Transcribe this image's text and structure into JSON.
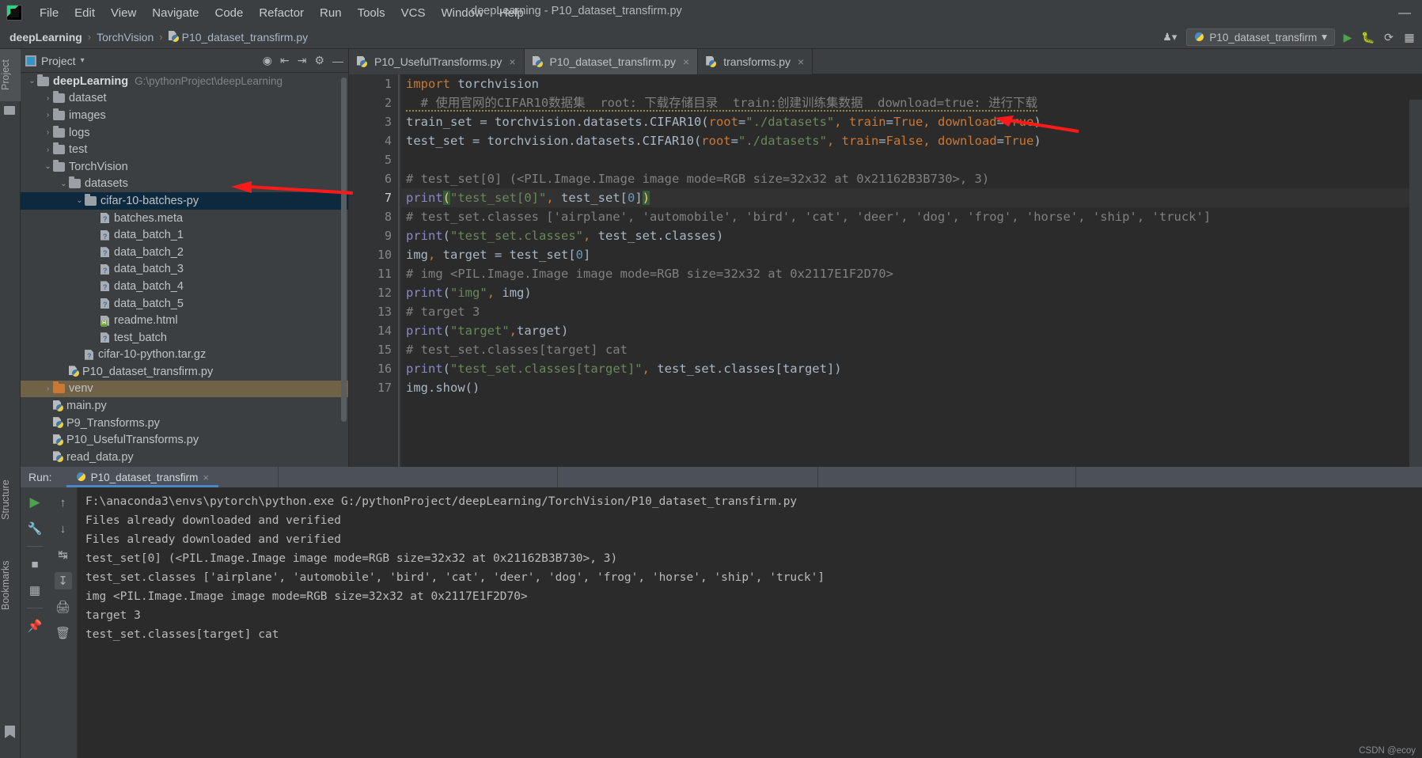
{
  "window": {
    "title": "deepLearning - P10_dataset_transfirm.py",
    "minimize_glyph": "—"
  },
  "menu": {
    "logo_text": "PC",
    "items": [
      "File",
      "Edit",
      "View",
      "Navigate",
      "Code",
      "Refactor",
      "Run",
      "Tools",
      "VCS",
      "Window",
      "Help"
    ]
  },
  "breadcrumb": {
    "items": [
      "deepLearning",
      "TorchVision",
      "P10_dataset_transfirm.py"
    ],
    "separator": "›"
  },
  "toolbar": {
    "account_glyph": "♟",
    "caret_glyph": "▾",
    "run_config": "P10_dataset_transfirm",
    "run_glyph": "▶",
    "debug_glyph": "⚙",
    "coverage_glyph": "⟳",
    "profile_glyph": "▦"
  },
  "left_strip": {
    "tabs": [
      "Project",
      "Structure",
      "Bookmarks"
    ]
  },
  "project_panel": {
    "title": "Project",
    "caret": "▾",
    "header_icons": [
      "locate-icon",
      "expand-all-icon",
      "collapse-all-icon",
      "settings-icon",
      "hide-icon"
    ],
    "tree": [
      {
        "label": "deepLearning",
        "path": "G:\\pythonProject\\deepLearning",
        "depth": 0,
        "arrow": "⌄",
        "icon": "folder",
        "bold": true,
        "state": "normal"
      },
      {
        "label": "dataset",
        "path": "",
        "depth": 1,
        "arrow": "›",
        "icon": "folder",
        "bold": false,
        "state": "normal"
      },
      {
        "label": "images",
        "path": "",
        "depth": 1,
        "arrow": "›",
        "icon": "folder",
        "bold": false,
        "state": "normal"
      },
      {
        "label": "logs",
        "path": "",
        "depth": 1,
        "arrow": "›",
        "icon": "folder",
        "bold": false,
        "state": "normal"
      },
      {
        "label": "test",
        "path": "",
        "depth": 1,
        "arrow": "›",
        "icon": "folder",
        "bold": false,
        "state": "normal"
      },
      {
        "label": "TorchVision",
        "path": "",
        "depth": 1,
        "arrow": "⌄",
        "icon": "folder",
        "bold": false,
        "state": "normal"
      },
      {
        "label": "datasets",
        "path": "",
        "depth": 2,
        "arrow": "⌄",
        "icon": "folder",
        "bold": false,
        "state": "normal"
      },
      {
        "label": "cifar-10-batches-py",
        "path": "",
        "depth": 3,
        "arrow": "⌄",
        "icon": "folder",
        "bold": false,
        "state": "selected"
      },
      {
        "label": "batches.meta",
        "path": "",
        "depth": 4,
        "arrow": "",
        "icon": "file-unknown",
        "bold": false,
        "state": "normal"
      },
      {
        "label": "data_batch_1",
        "path": "",
        "depth": 4,
        "arrow": "",
        "icon": "file-unknown",
        "bold": false,
        "state": "normal"
      },
      {
        "label": "data_batch_2",
        "path": "",
        "depth": 4,
        "arrow": "",
        "icon": "file-unknown",
        "bold": false,
        "state": "normal"
      },
      {
        "label": "data_batch_3",
        "path": "",
        "depth": 4,
        "arrow": "",
        "icon": "file-unknown",
        "bold": false,
        "state": "normal"
      },
      {
        "label": "data_batch_4",
        "path": "",
        "depth": 4,
        "arrow": "",
        "icon": "file-unknown",
        "bold": false,
        "state": "normal"
      },
      {
        "label": "data_batch_5",
        "path": "",
        "depth": 4,
        "arrow": "",
        "icon": "file-unknown",
        "bold": false,
        "state": "normal"
      },
      {
        "label": "readme.html",
        "path": "",
        "depth": 4,
        "arrow": "",
        "icon": "file-html",
        "bold": false,
        "state": "normal"
      },
      {
        "label": "test_batch",
        "path": "",
        "depth": 4,
        "arrow": "",
        "icon": "file-unknown",
        "bold": false,
        "state": "normal"
      },
      {
        "label": "cifar-10-python.tar.gz",
        "path": "",
        "depth": 3,
        "arrow": "",
        "icon": "file-unknown",
        "bold": false,
        "state": "normal"
      },
      {
        "label": "P10_dataset_transfirm.py",
        "path": "",
        "depth": 2,
        "arrow": "",
        "icon": "file-python",
        "bold": false,
        "state": "normal"
      },
      {
        "label": "venv",
        "path": "",
        "depth": 1,
        "arrow": "›",
        "icon": "folder-orange",
        "bold": false,
        "state": "venv"
      },
      {
        "label": "main.py",
        "path": "",
        "depth": 1,
        "arrow": "",
        "icon": "file-python",
        "bold": false,
        "state": "normal"
      },
      {
        "label": "P9_Transforms.py",
        "path": "",
        "depth": 1,
        "arrow": "",
        "icon": "file-python",
        "bold": false,
        "state": "normal"
      },
      {
        "label": "P10_UsefulTransforms.py",
        "path": "",
        "depth": 1,
        "arrow": "",
        "icon": "file-python",
        "bold": false,
        "state": "normal"
      },
      {
        "label": "read_data.py",
        "path": "",
        "depth": 1,
        "arrow": "",
        "icon": "file-python",
        "bold": false,
        "state": "normal"
      }
    ]
  },
  "editor": {
    "tabs": [
      {
        "label": "P10_UsefulTransforms.py",
        "active": false,
        "close": "×"
      },
      {
        "label": "P10_dataset_transfirm.py",
        "active": true,
        "close": "×"
      },
      {
        "label": "transforms.py",
        "active": false,
        "close": "×"
      }
    ],
    "current_line": 7,
    "line_numbers": [
      "1",
      "2",
      "3",
      "4",
      "5",
      "6",
      "7",
      "8",
      "9",
      "10",
      "11",
      "12",
      "13",
      "14",
      "15",
      "16",
      "17"
    ],
    "lines": [
      "import torchvision",
      "  # 使用官网的CIFAR10数据集  root: 下载存储目录  train:创建训练集数据  download=true: 进行下载",
      "train_set = torchvision.datasets.CIFAR10(root=\"./datasets\", train=True, download=True)",
      "test_set = torchvision.datasets.CIFAR10(root=\"./datasets\", train=False, download=True)",
      "",
      "# test_set[0] (<PIL.Image.Image image mode=RGB size=32x32 at 0x21162B3B730>, 3)",
      "print(\"test_set[0]\", test_set[0])",
      "# test_set.classes ['airplane', 'automobile', 'bird', 'cat', 'deer', 'dog', 'frog', 'horse', 'ship', 'truck']",
      "print(\"test_set.classes\", test_set.classes)",
      "img, target = test_set[0]",
      "# img <PIL.Image.Image image mode=RGB size=32x32 at 0x2117E1F2D70>",
      "print(\"img\", img)",
      "# target 3",
      "print(\"target\",target)",
      "# test_set.classes[target] cat",
      "print(\"test_set.classes[target]\", test_set.classes[target])",
      "img.show()"
    ]
  },
  "run_panel": {
    "label": "Run:",
    "tab_name": "P10_dataset_transfirm",
    "tab_close": "×",
    "toolbar_icons": [
      "rerun-icon",
      "stop-icon",
      "dump-threads-icon",
      "pin-icon",
      "up-icon",
      "down-icon",
      "soft-wrap-icon",
      "scroll-to-end-icon",
      "print-icon",
      "trash-icon"
    ],
    "console": [
      "F:\\anaconda3\\envs\\pytorch\\python.exe G:/pythonProject/deepLearning/TorchVision/P10_dataset_transfirm.py",
      "Files already downloaded and verified",
      "Files already downloaded and verified",
      "test_set[0] (<PIL.Image.Image image mode=RGB size=32x32 at 0x21162B3B730>, 3)",
      "test_set.classes ['airplane', 'automobile', 'bird', 'cat', 'deer', 'dog', 'frog', 'horse', 'ship', 'truck']",
      "img <PIL.Image.Image image mode=RGB size=32x32 at 0x2117E1F2D70>",
      "target 3",
      "test_set.classes[target] cat"
    ]
  },
  "watermark": "CSDN @ecoy",
  "colors": {
    "accent_blue": "#4a88c7",
    "selection": "#0d293e",
    "venv_highlight": "#6f6247",
    "keyword": "#cc7832",
    "string": "#6a8759",
    "comment": "#808080",
    "function": "#8888c6",
    "number": "#6897bb",
    "arrow_red": "#ff1a1a"
  }
}
